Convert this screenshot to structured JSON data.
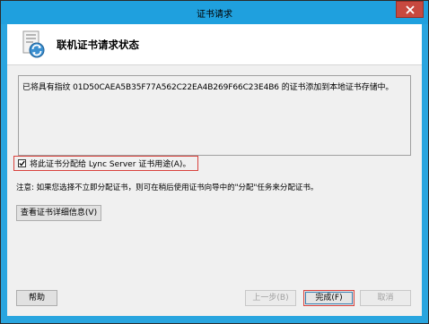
{
  "window": {
    "title": "证书请求",
    "close_icon": "close-icon"
  },
  "header": {
    "title": "联机证书请求状态",
    "icon": "certificate-refresh-icon"
  },
  "info": {
    "message": "已将具有指纹 01D50CAEA5B35F77A562C22EA4B269F66C23E4B6 的证书添加到本地证书存储中。"
  },
  "assign": {
    "checked": true,
    "label": "将此证书分配给 Lync Server 证书用途(A)。"
  },
  "note": "注意: 如果您选择不立即分配证书，则可在稍后使用证书向导中的\"分配\"任务来分配证书。",
  "buttons": {
    "view_details": "查看证书详细信息(V)",
    "help": "帮助",
    "back": "上一步(B)",
    "finish": "完成(F)",
    "cancel": "取消"
  },
  "colors": {
    "title_bar": "#1fa0de",
    "close_button": "#c7493f",
    "highlight_border": "#d9423d"
  }
}
